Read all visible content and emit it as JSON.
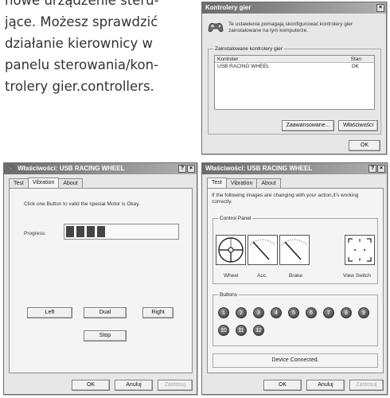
{
  "manual": {
    "lines": [
      "nowe urządzenie steru-",
      "jące. Możesz sprawdzić",
      "działanie kierownicy w",
      "panelu sterowania/kon-",
      "trolery gier.controllers."
    ]
  },
  "game_controllers": {
    "title": "Kontrolery gier",
    "close": "×",
    "intro": "Te ustawienia pomagają skonfigurować kontrolery gier zainstalowane na tym komputerze.",
    "group_label": "Zainstalowane kontrolery gier",
    "table": {
      "headers": [
        "Kontroler",
        "Stan"
      ],
      "rows": [
        [
          "USB RACING WHEEL",
          "OK"
        ]
      ]
    },
    "advanced_button": "Zaawansowane...",
    "properties_button": "Właściwości",
    "ok_button": "OK"
  },
  "props_vibration": {
    "title": "Właściwości: USB RACING WHEEL",
    "help": "?",
    "close": "×",
    "tabs": [
      "Test",
      "Vibration",
      "About"
    ],
    "active_tab": "Vibration",
    "instruction": "Click one Button to valid the special Motor is Okay.",
    "progress_label": "Progress:",
    "progress_segments": 4,
    "buttons": {
      "left": "Left",
      "dual": "Dual",
      "right": "Right",
      "stop": "Stop"
    },
    "footer": {
      "ok": "OK",
      "cancel": "Anuluj",
      "apply": "Zastosuj"
    }
  },
  "props_test": {
    "title": "Właściwości: USB RACING WHEEL",
    "help": "?",
    "close": "×",
    "tabs": [
      "Test",
      "Vibration",
      "About"
    ],
    "active_tab": "Test",
    "instruction": "If the following images are changing with your action,it's working correctly.",
    "control_panel_label": "Control Panel",
    "controls": [
      "Wheel",
      "Acc.",
      "Brake",
      "View Switch"
    ],
    "buttons_label": "Buttons",
    "button_numbers": [
      "1",
      "2",
      "3",
      "4",
      "5",
      "6",
      "7",
      "8",
      "9",
      "10",
      "11",
      "12"
    ],
    "status": "Device Connected.",
    "footer": {
      "ok": "OK",
      "cancel": "Anuluj",
      "apply": "Zastosuj"
    }
  }
}
